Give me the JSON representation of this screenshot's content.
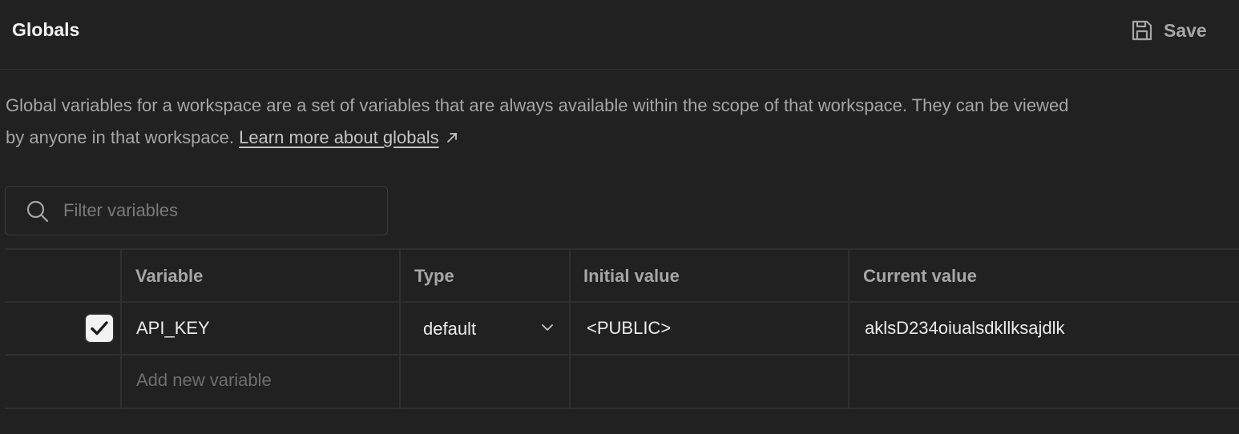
{
  "header": {
    "title": "Globals",
    "save_label": "Save",
    "save_icon": "floppy-disk-icon"
  },
  "description": {
    "line1": "Global variables for a workspace are a set of variables that are always available within the scope of that workspace. They can be viewed",
    "line2_prefix": "by anyone in that workspace.",
    "link_text": "Learn more about globals",
    "link_icon": "external-link-arrow-icon"
  },
  "filter": {
    "placeholder": "Filter variables",
    "value": "",
    "icon": "search-icon"
  },
  "table": {
    "columns": [
      "Variable",
      "Type",
      "Initial value",
      "Current value"
    ],
    "rows": [
      {
        "enabled": true,
        "variable": "API_KEY",
        "type": "default",
        "initial_value": "<PUBLIC>",
        "current_value": "aklsD234oiualsdkllksajdlk"
      }
    ],
    "add_placeholder": "Add new variable"
  },
  "colors": {
    "background": "#212121",
    "border": "#2f2f2f",
    "text_primary": "#ececec",
    "text_muted": "#a6a6a6",
    "placeholder": "#6e6e6e"
  }
}
